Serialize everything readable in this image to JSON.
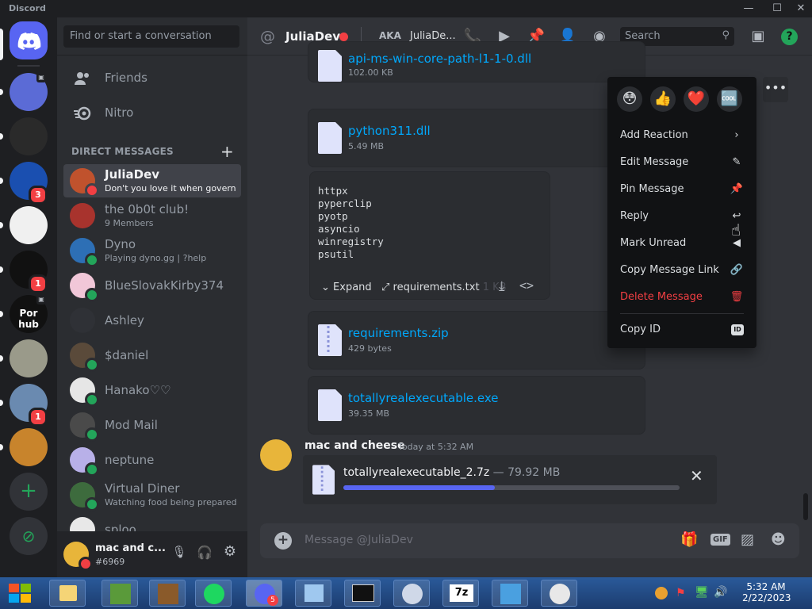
{
  "window": {
    "title": "Discord"
  },
  "dm_sidebar": {
    "search_placeholder": "Find or start a conversation",
    "nav": [
      {
        "label": "Friends",
        "icon": "friends-icon"
      },
      {
        "label": "Nitro",
        "icon": "nitro-icon"
      }
    ],
    "section_title": "DIRECT MESSAGES",
    "dms": [
      {
        "name": "JuliaDev",
        "sub": "Don't you love it when govern...",
        "status": "dnd",
        "selected": true,
        "color": "#c0522d"
      },
      {
        "name": "the 0b0t club!",
        "sub": "9 Members",
        "status": "",
        "color": "#a8332d"
      },
      {
        "name": "Dyno",
        "sub": "Playing dyno.gg | ?help",
        "status": "online",
        "color": "#2d6fb5"
      },
      {
        "name": "BlueSlovakKirby374",
        "sub": "",
        "status": "online",
        "color": "#f1c7d8"
      },
      {
        "name": "Ashley",
        "sub": "",
        "status": "",
        "color": "#2f3136"
      },
      {
        "name": "$daniel",
        "sub": "",
        "status": "online",
        "color": "#5a4a3a"
      },
      {
        "name": "Hanako♡♡",
        "sub": "",
        "status": "online",
        "color": "#e6e6e6"
      },
      {
        "name": "Mod Mail",
        "sub": "",
        "status": "online",
        "color": "#4a4a4a"
      },
      {
        "name": "neptune",
        "sub": "",
        "status": "online",
        "color": "#b8b0e8"
      },
      {
        "name": "Virtual Diner",
        "sub": "Watching food being prepared!",
        "status": "online",
        "color": "#3d6b3d"
      },
      {
        "name": "sploo",
        "sub": "",
        "status": "",
        "color": "#e8e8e8"
      }
    ],
    "user": {
      "name": "mac and c...",
      "tag": "#6969"
    }
  },
  "servers": [
    {
      "color": "#5b6bd6",
      "badge": "",
      "speaker": true
    },
    {
      "color": "#2a2a2a",
      "badge": "",
      "speaker": false
    },
    {
      "color": "#1a4fb0",
      "badge": "3",
      "speaker": false
    },
    {
      "color": "#f0f0f0",
      "badge": "",
      "speaker": false
    },
    {
      "color": "#111111",
      "badge": "1",
      "speaker": false
    },
    {
      "color": "#111111",
      "badge": "",
      "speaker": true,
      "text": "Por hub"
    },
    {
      "color": "#9a9a8a",
      "badge": "",
      "speaker": false
    },
    {
      "color": "#6a8ab0",
      "badge": "1",
      "speaker": false
    },
    {
      "color": "#c8842c",
      "badge": "",
      "speaker": false
    }
  ],
  "chat": {
    "channel": "JuliaDev",
    "aka_label": "AKA",
    "aka_name": "JuliaDe...",
    "search_placeholder": "Search",
    "attachments": [
      {
        "name": "api-ms-win-core-path-l1-1-0.dll",
        "size": "102.00 KB"
      },
      {
        "name": "python311.dll",
        "size": "5.49 MB"
      },
      {
        "name": "requirements.zip",
        "size": "429 bytes"
      },
      {
        "name": "totallyrealexecutable.exe",
        "size": "39.35 MB"
      }
    ],
    "code_lines": "httpx\npyperclip\npyotp\nasyncio\nwinregistry\npsutil",
    "code_expand": "Expand",
    "code_file": "requirements.txt",
    "code_size": "1 KB",
    "message_author": "mac and cheese",
    "message_time": "Today at 5:32 AM",
    "upload_name": "totallyrealexecutable_2.7z",
    "upload_size": "— 79.92 MB",
    "upload_progress": 0.45,
    "composer_placeholder": "Message @JuliaDev"
  },
  "menu": {
    "reactions": [
      "😳",
      "👍",
      "❤️",
      "🆒"
    ],
    "items": [
      {
        "label": "Add Reaction",
        "icon": "›",
        "danger": false
      },
      {
        "label": "Edit Message",
        "icon": "✎",
        "danger": false
      },
      {
        "label": "Pin Message",
        "icon": "📌",
        "danger": false
      },
      {
        "label": "Reply",
        "icon": "↩",
        "danger": false
      },
      {
        "label": "Mark Unread",
        "icon": "◀",
        "danger": false
      },
      {
        "label": "Copy Message Link",
        "icon": "🔗",
        "danger": false
      },
      {
        "label": "Delete Message",
        "icon": "🗑",
        "danger": true
      },
      {
        "label": "Copy ID",
        "icon": "ID",
        "danger": false
      }
    ]
  },
  "taskbar": {
    "time": "5:32 AM",
    "date": "2/22/2023",
    "discord_badge": "5"
  },
  "colors": {
    "accent": "#5865f2",
    "link": "#00a8fc",
    "danger": "#f23f43",
    "online": "#23a55a"
  }
}
